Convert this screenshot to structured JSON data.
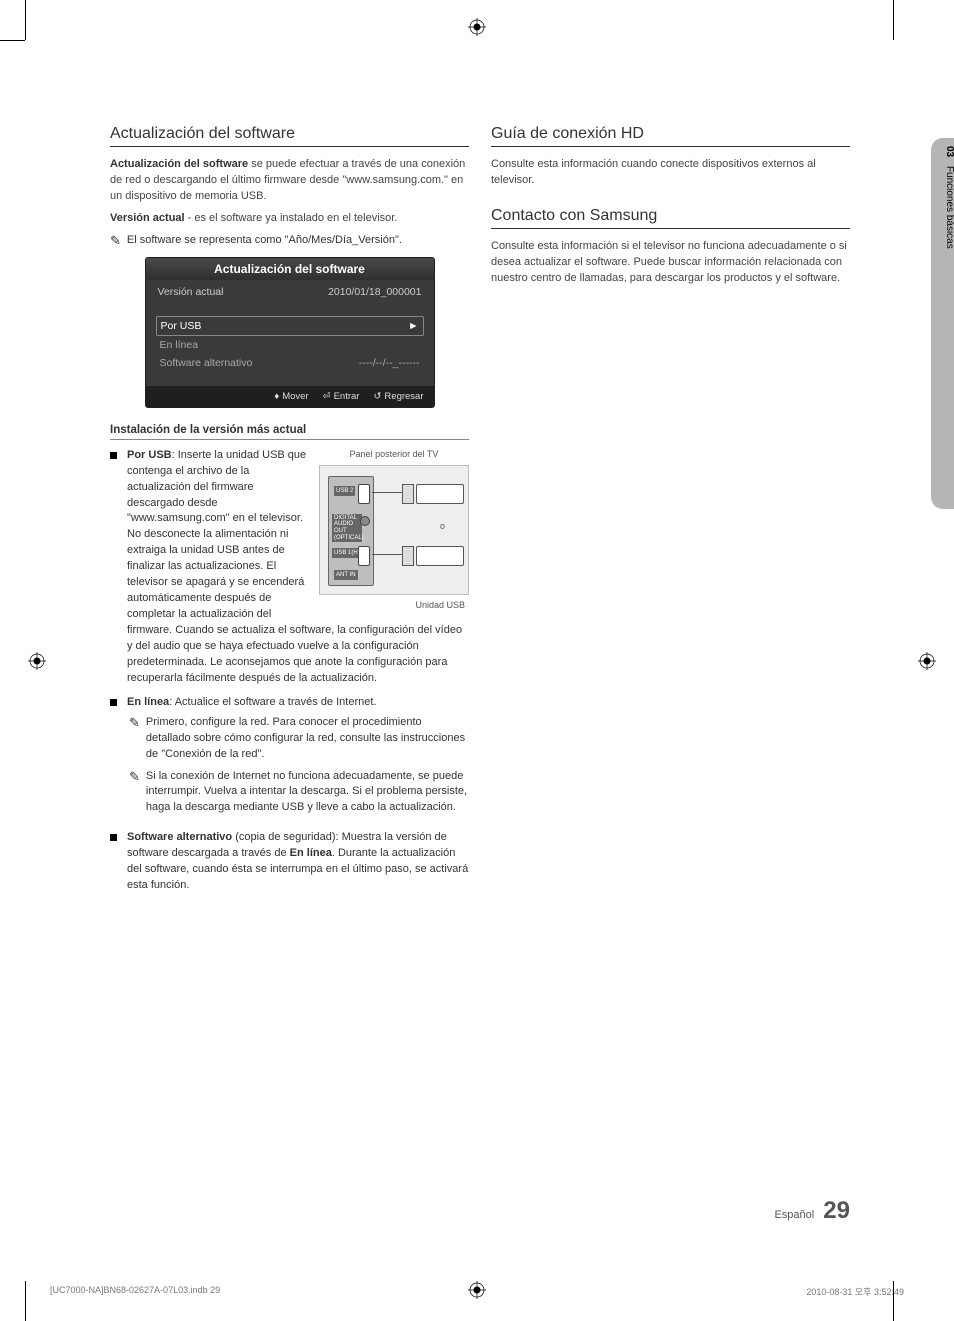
{
  "side_tab": {
    "num": "03",
    "label": "Funciones básicas"
  },
  "left": {
    "h_sw": "Actualización del software",
    "p1_bold": "Actualización del software",
    "p1_rest": " se puede efectuar a través de una conexión de red o descargando el último firmware desde \"www.samsung.com.\" en un dispositivo de memoria USB.",
    "p2_bold": "Versión actual",
    "p2_rest": " - es el software ya instalado en el televisor.",
    "note1": "El software se representa como \"Año/Mes/Día_Versión\".",
    "osd": {
      "title": "Actualización del software",
      "row_label": "Versión actual",
      "row_value": "2010/01/18_000001",
      "items": [
        {
          "label": "Por USB",
          "value": "►",
          "sel": true
        },
        {
          "label": "En línea",
          "value": "",
          "sel": false
        },
        {
          "label": "Software alternativo",
          "value": "----/--/--_------",
          "sel": false
        }
      ],
      "footer": {
        "move": "Mover",
        "enter": "Entrar",
        "return": "Regresar"
      }
    },
    "subhead": "Instalación de la versión más actual",
    "panel_top": "Panel posterior del TV",
    "panel_bottom": "Unidad USB",
    "b1_bold": "Por USB",
    "b1_after": ": Inserte la unidad USB que contenga el archivo de la actualización del firmware descargado desde \"www.samsung.com\" en el televisor. No desconecte la alimentación ni extraiga la unidad USB antes de finalizar las actualizaciones. El televisor se apagará y se encenderá automáticamente después de completar la actualización del firmware. Cuando se actualiza el software, la configuración del vídeo y del audio que se haya efectuado vuelve a la configuración predeterminada. Le aconsejamos que anote la configuración para recuperarla fácilmente después de la actualización.",
    "b2_bold": "En línea",
    "b2_after": ": Actualice el software a través de Internet.",
    "sn1": "Primero, configure la red. Para conocer el procedimiento detallado sobre cómo configurar la red, consulte las instrucciones de \"Conexión de la red\".",
    "sn2": "Si la conexión de Internet no funciona adecuadamente, se puede interrumpir. Vuelva a intentar la descarga. Si el problema persiste, haga la descarga mediante USB y lleve a cabo la actualización.",
    "b3_bold": "Software alternativo",
    "b3_mid": " (copia de seguridad): Muestra la versión de software descargada a través de ",
    "b3_bold2": "En línea",
    "b3_after": ". Durante la actualización del software, cuando ésta se interrumpa en el último paso, se activará esta función."
  },
  "right": {
    "h_hd": "Guía de conexión HD",
    "p_hd": "Consulte esta información cuando conecte dispositivos externos al televisor.",
    "h_contact": "Contacto con Samsung",
    "p_contact": "Consulte esta información si el televisor no funciona adecuadamente o si desea actualizar el software. Puede buscar información relacionada con nuestro centro de llamadas, para descargar los productos y el software."
  },
  "footer": {
    "lang": "Español",
    "num": "29"
  },
  "print": {
    "left": "[UC7000-NA]BN68-02627A-07L03.indb   29",
    "right": "2010-08-31   오후 3:52:49"
  }
}
